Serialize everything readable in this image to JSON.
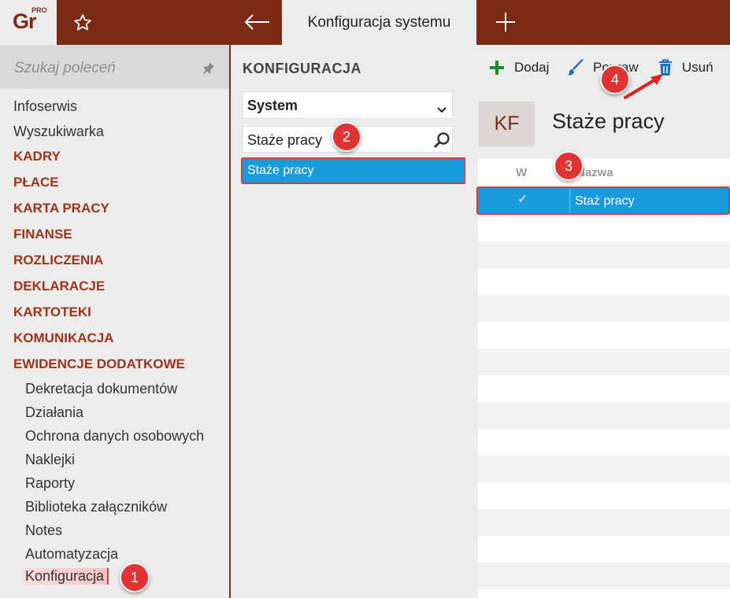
{
  "header": {
    "logo_text": "Gr",
    "logo_sup": "PRO",
    "active_tab": "Konfiguracja systemu"
  },
  "sidebar": {
    "search_placeholder": "Szukaj poleceń",
    "items": [
      {
        "label": "Infoserwis"
      },
      {
        "label": "Wyszukiwarka"
      },
      {
        "label": "KADRY"
      },
      {
        "label": "PŁACE"
      },
      {
        "label": "KARTA PRACY"
      },
      {
        "label": "FINANSE"
      },
      {
        "label": "ROZLICZENIA"
      },
      {
        "label": "DEKLARACJE"
      },
      {
        "label": "KARTOTEKI"
      },
      {
        "label": "KOMUNIKACJA"
      },
      {
        "label": "EWIDENCJE DODATKOWE"
      }
    ],
    "sub_items": [
      {
        "label": "Dekretacja dokumentów"
      },
      {
        "label": "Działania"
      },
      {
        "label": "Ochrona danych osobowych"
      },
      {
        "label": "Naklejki"
      },
      {
        "label": "Raporty"
      },
      {
        "label": "Biblioteka załączników"
      },
      {
        "label": "Notes"
      },
      {
        "label": "Automatyzacja"
      },
      {
        "label": "Konfiguracja"
      }
    ]
  },
  "middle": {
    "title": "KONFIGURACJA",
    "select_value": "System",
    "search_value": "Staże pracy",
    "list_items": [
      {
        "label": "Staże pracy"
      }
    ]
  },
  "toolbar": {
    "add_label": "Dodaj",
    "edit_label": "Popraw",
    "delete_label": "Usuń"
  },
  "content": {
    "badge": "KF",
    "title": "Staże pracy",
    "columns": {
      "w": "W",
      "nazwa": "Nazwa"
    },
    "rows": [
      {
        "checked": "✓",
        "name": "Staż pracy"
      }
    ]
  },
  "annotations": [
    "1",
    "2",
    "3",
    "4"
  ],
  "colors": {
    "brand": "#7a2a15",
    "selection": "#1a9be0",
    "highlight": "#d83b3b"
  }
}
